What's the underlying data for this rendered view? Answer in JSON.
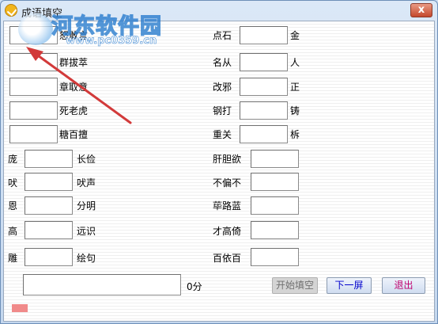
{
  "window": {
    "title": "成语填空",
    "close_label": "x"
  },
  "watermark": {
    "name": "河东软件园",
    "url": "www.pc0359.cn"
  },
  "left_rows": [
    {
      "pre": "",
      "post": "怒敢言"
    },
    {
      "pre": "",
      "post": "群拔萃"
    },
    {
      "pre": "",
      "post": "章取意"
    },
    {
      "pre": "",
      "post": "死老虎"
    },
    {
      "pre": "",
      "post": "糖百擅"
    },
    {
      "pre": "庞",
      "post": "长俭"
    },
    {
      "pre": "吠",
      "post": "吠声"
    },
    {
      "pre": "恩",
      "post": "分明"
    },
    {
      "pre": "高",
      "post": "远识"
    },
    {
      "pre": "雕",
      "post": "绘句"
    }
  ],
  "right_rows": [
    {
      "pre": "点石",
      "post": "金"
    },
    {
      "pre": "名从",
      "post": "人"
    },
    {
      "pre": "改邪",
      "post": "正"
    },
    {
      "pre": "钢打",
      "post": "铸"
    },
    {
      "pre": "重关",
      "post": "柝"
    },
    {
      "pre": "肝胆欲",
      "post": ""
    },
    {
      "pre": "不偏不",
      "post": ""
    },
    {
      "pre": "荜路蓝",
      "post": ""
    },
    {
      "pre": "才高倚",
      "post": ""
    },
    {
      "pre": "百依百",
      "post": ""
    }
  ],
  "bottom": {
    "answer_value": "",
    "score": "0分",
    "start_label": "开始填空",
    "next_label": "下一屏",
    "exit_label": "退出"
  },
  "colors": {
    "next_text": "#0000cc",
    "exit_text": "#c0006e",
    "arrow": "#d23a3a",
    "indicator": "#f08a8a"
  }
}
